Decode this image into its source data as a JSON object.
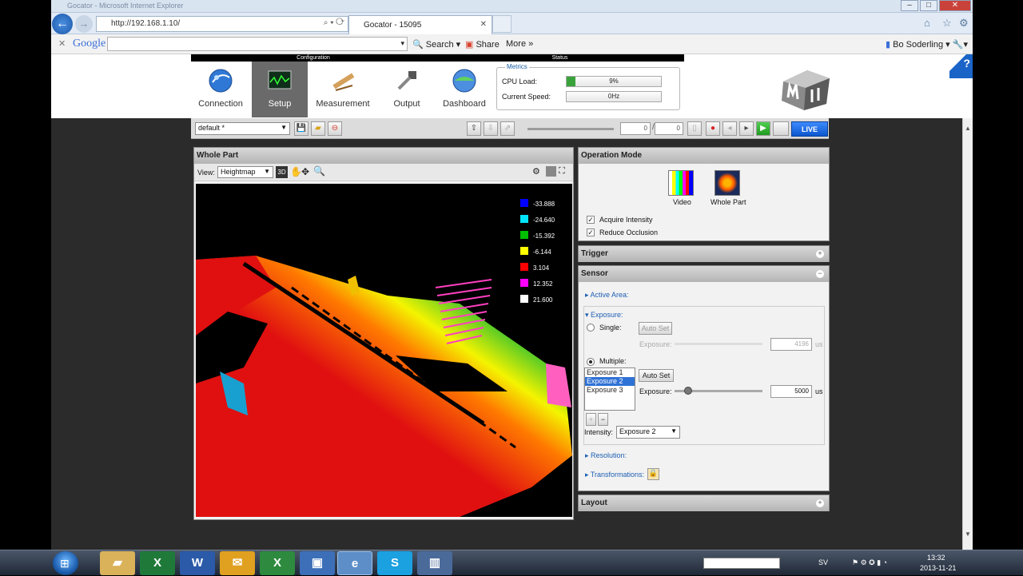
{
  "browser": {
    "title": "Gocator - Microsoft Internet Explorer",
    "url": "http://192.168.1.10/",
    "tab_title": "Gocator - 15095",
    "google": {
      "logo": "Google",
      "search": "Search",
      "share": "Share",
      "more": "More",
      "user": "Bo Soderling"
    }
  },
  "nav": {
    "configuration_caption": "Configuration",
    "status_caption": "Status",
    "items": [
      {
        "label": "Connection",
        "icon": "connection-icon"
      },
      {
        "label": "Setup",
        "icon": "setup-icon",
        "active": true
      },
      {
        "label": "Measurement",
        "icon": "measurement-icon"
      },
      {
        "label": "Output",
        "icon": "output-icon"
      },
      {
        "label": "Dashboard",
        "icon": "dashboard-icon"
      }
    ]
  },
  "metrics": {
    "title": "Metrics",
    "cpu_label": "CPU Load:",
    "cpu_value": "9%",
    "cpu_fraction": 0.09,
    "speed_label": "Current Speed:",
    "speed_value": "0Hz"
  },
  "toolbar": {
    "job_select": "default *",
    "frame_current": "0",
    "frame_total": "0",
    "live_label": "LIVE"
  },
  "whole_part": {
    "title": "Whole Part",
    "view_label": "View:",
    "view_value": "Heightmap",
    "mode_3d": "3D",
    "legend": [
      {
        "value": "-33.888",
        "color": "#0000ff"
      },
      {
        "value": "-24.640",
        "color": "#00e5ff"
      },
      {
        "value": "-15.392",
        "color": "#00c000"
      },
      {
        "value": "-6.144",
        "color": "#ffff00"
      },
      {
        "value": "3.104",
        "color": "#ff0000"
      },
      {
        "value": "12.352",
        "color": "#ff00ff"
      },
      {
        "value": "21.600",
        "color": "#ffffff"
      }
    ]
  },
  "operation_mode": {
    "title": "Operation Mode",
    "video_label": "Video",
    "whole_part_label": "Whole Part",
    "acquire_intensity": "Acquire Intensity",
    "reduce_occlusion": "Reduce Occlusion"
  },
  "trigger": {
    "title": "Trigger"
  },
  "sensor": {
    "title": "Sensor",
    "active_area": "Active Area:",
    "exposure_header": "Exposure:",
    "single_label": "Single:",
    "auto_set": "Auto Set",
    "exposure_label": "Exposure:",
    "single_value": "4196",
    "unit": "us",
    "multiple_label": "Multiple:",
    "exposures": [
      "Exposure 1",
      "Exposure 2",
      "Exposure 3"
    ],
    "selected_exposure": "Exposure 2",
    "multiple_value": "5000",
    "intensity_label": "Intensity:",
    "intensity_value": "Exposure 2",
    "resolution": "Resolution:",
    "transformations": "Transformations:"
  },
  "layout": {
    "title": "Layout"
  },
  "taskbar": {
    "lang": "SV",
    "time": "13:32",
    "date": "2013-11-21"
  }
}
